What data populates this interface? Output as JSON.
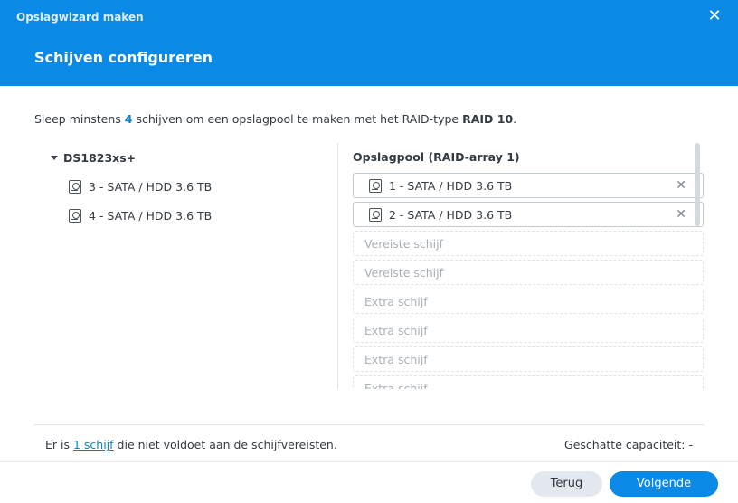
{
  "window": {
    "title": "Opslagwizard maken",
    "close_symbol": "✕"
  },
  "step": {
    "title": "Schijven configureren"
  },
  "instruction": {
    "prefix": "Sleep minstens ",
    "count": "4",
    "middle": " schijven om een opslagpool te maken met het RAID-type ",
    "raid_type": "RAID 10",
    "suffix": "."
  },
  "available": {
    "device": "DS1823xs+",
    "disks": [
      {
        "label": "3 - SATA / HDD 3.6 TB",
        "icon": "hdd-icon"
      },
      {
        "label": "4 - SATA / HDD 3.6 TB",
        "icon": "hdd-icon"
      }
    ]
  },
  "pool": {
    "title": "Opslagpool (RAID-array 1)",
    "assigned": [
      {
        "label": "1 - SATA / HDD 3.6 TB",
        "icon": "hdd-icon",
        "remove": "✕"
      },
      {
        "label": "2 - SATA / HDD 3.6 TB",
        "icon": "hdd-icon",
        "remove": "✕"
      }
    ],
    "placeholders": [
      "Vereiste schijf",
      "Vereiste schijf",
      "Extra schijf",
      "Extra schijf",
      "Extra schijf",
      "Extra schijf"
    ]
  },
  "footer": {
    "warning_prefix": "Er is ",
    "warning_link": "1 schijf",
    "warning_suffix": " die niet voldoet aan de schijfvereisten.",
    "capacity": "Geschatte capaciteit: -"
  },
  "buttons": {
    "back": "Terug",
    "next": "Volgende"
  },
  "colors": {
    "accent": "#0a8ae6",
    "link": "#0a7fd6",
    "placeholder_text": "#a9b0b7"
  }
}
